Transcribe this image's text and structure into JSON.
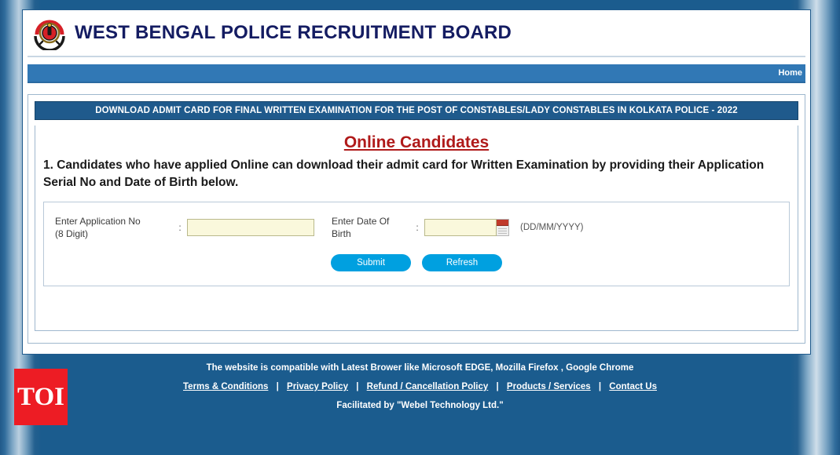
{
  "header": {
    "title": "WEST BENGAL POLICE RECRUITMENT BOARD",
    "logo_icon": "wbprb-emblem-icon"
  },
  "nav": {
    "home_label": "Home"
  },
  "panel": {
    "title": "DOWNLOAD ADMIT CARD FOR FINAL WRITTEN EXAMINATION FOR THE POST OF CONSTABLES/LADY CONSTABLES IN KOLKATA POLICE - 2022",
    "section_heading": "Online Candidates",
    "instructions": "1. Candidates who have applied Online can download their admit card for Written Examination by providing their Application Serial No and Date of Birth below."
  },
  "form": {
    "application_label_line1": "Enter Application No",
    "application_label_line2": "(8 Digit)",
    "application_colon": ":",
    "application_value": "",
    "application_placeholder": "",
    "dob_label": "Enter Date Of Birth",
    "dob_colon": ":",
    "dob_value": "",
    "dob_placeholder": "",
    "dob_format_hint": "(DD/MM/YYYY)",
    "calendar_icon": "calendar-icon",
    "submit_label": "Submit",
    "refresh_label": "Refresh"
  },
  "footer": {
    "compatibility": "The website is compatible with Latest Brower like Microsoft EDGE, Mozilla Firefox , Google Chrome",
    "links": [
      "Terms & Conditions",
      "Privacy Policy",
      "Refund / Cancellation Policy",
      "Products / Services",
      "Contact Us"
    ],
    "separator": "|",
    "facilitated": "Facilitated by \"Webel Technology Ltd.\"",
    "watermark": "TOI"
  },
  "colors": {
    "frame_blue": "#1b5c8e",
    "nav_blue": "#3178b5",
    "panel_title_blue": "#1f5a8c",
    "heading_red": "#b01a1a",
    "button_cyan": "#00a0e0",
    "input_cream": "#faf8dc",
    "brand_navy": "#141c62",
    "toi_red": "#ed1c24"
  }
}
